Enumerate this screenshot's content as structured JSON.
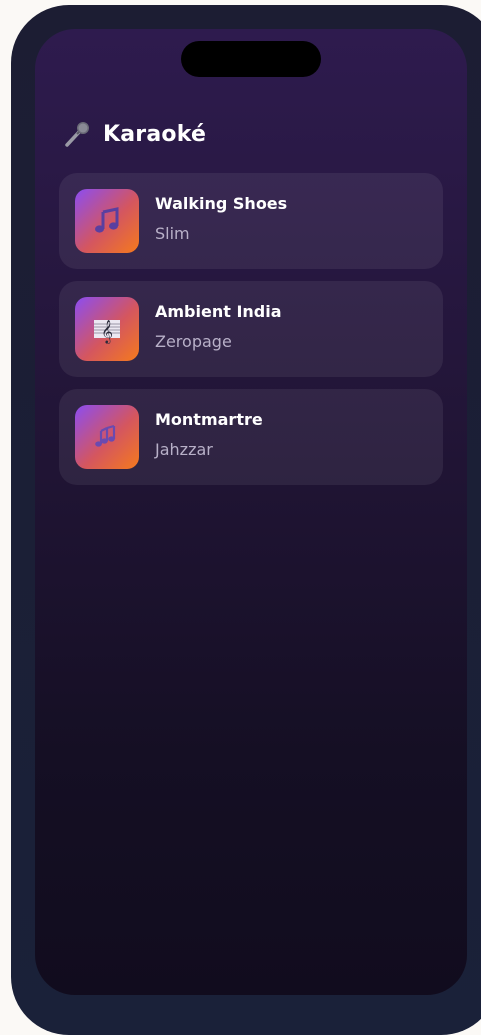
{
  "app": {
    "title": "Karaoké",
    "title_icon": "microphone-icon"
  },
  "songs": [
    {
      "title": "Walking Shoes",
      "artist": "Slim",
      "icon": "music-note-icon"
    },
    {
      "title": "Ambient India",
      "artist": "Zeropage",
      "icon": "musical-score-icon"
    },
    {
      "title": "Montmartre",
      "artist": "Jahzzar",
      "icon": "music-notes-icon"
    }
  ],
  "colors": {
    "screen_top": "#2e1b4e",
    "screen_bottom": "#110c1e",
    "thumb_gradient_start": "#8b4df2",
    "thumb_gradient_end": "#f57a1c"
  }
}
